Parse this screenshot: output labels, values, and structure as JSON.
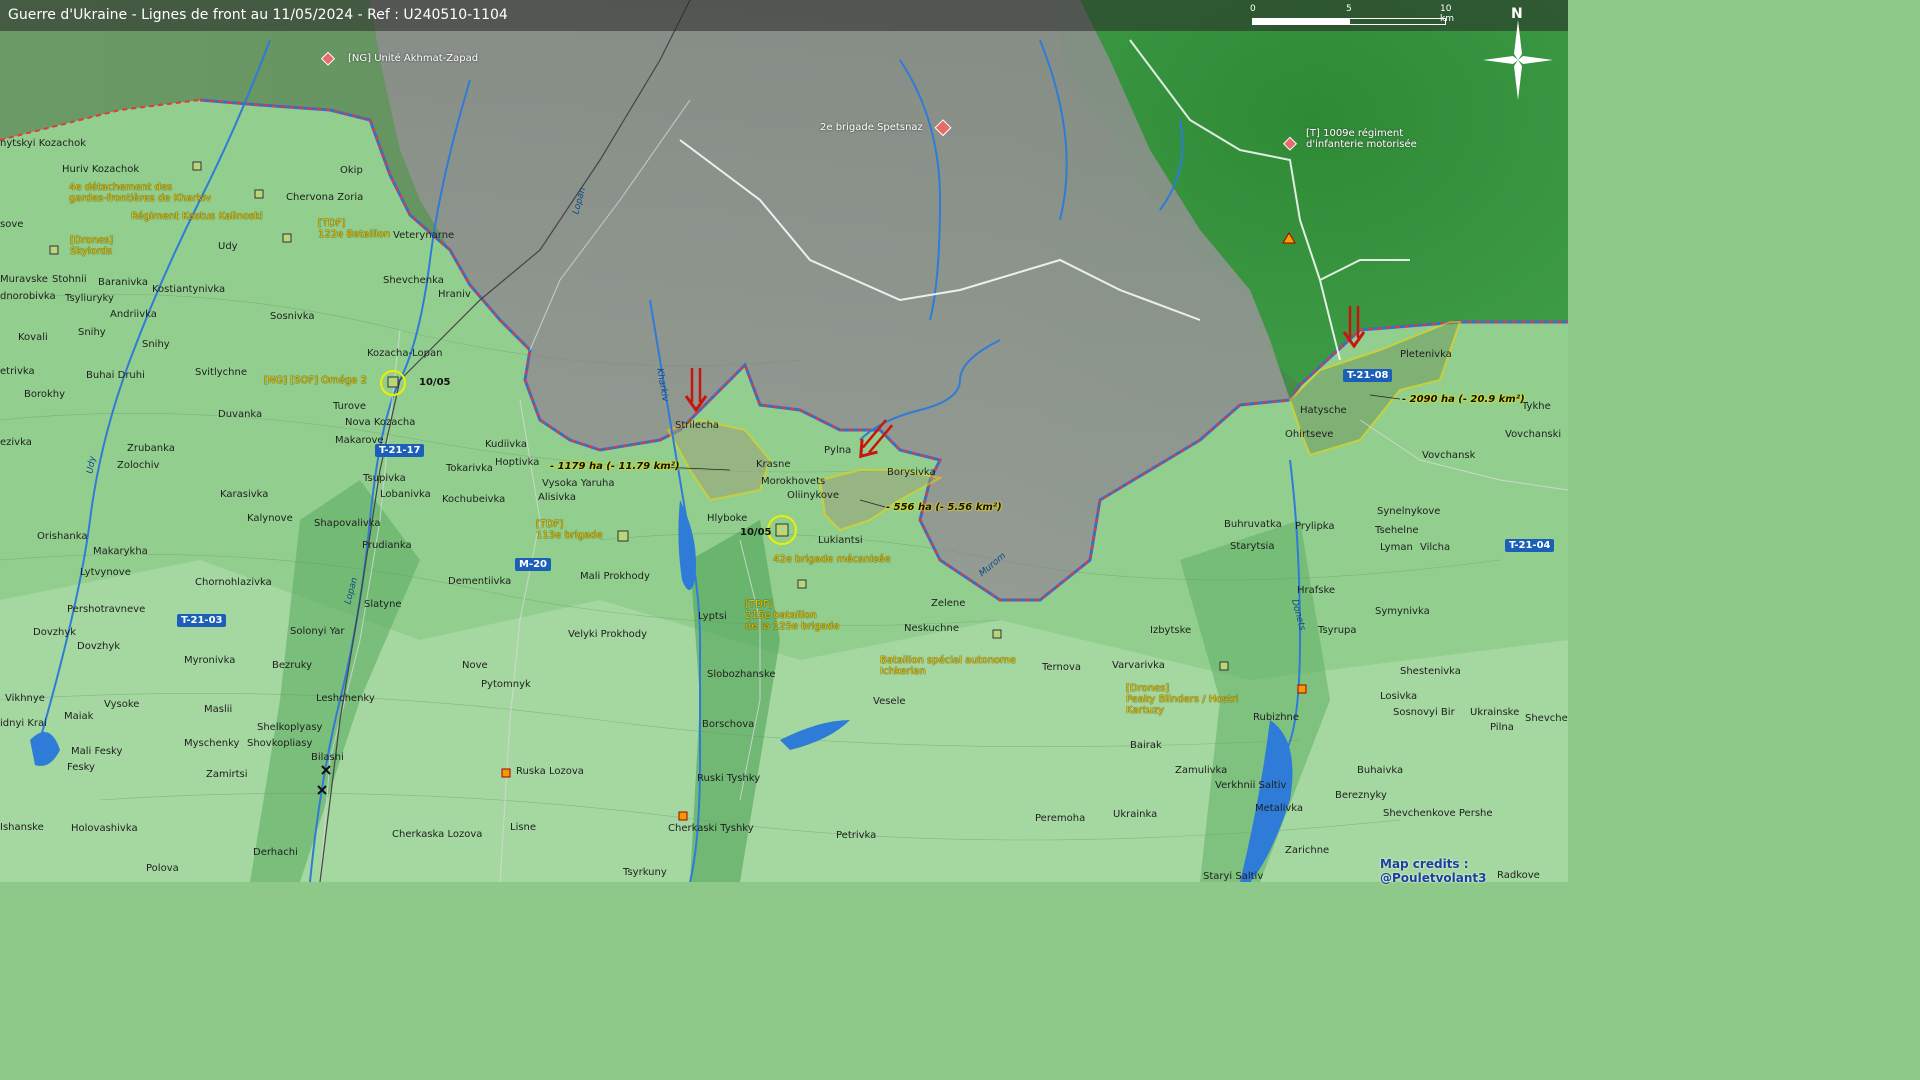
{
  "title": "Guerre d'Ukraine - Lignes de front au 11/05/2024 - Ref : U240510-1104",
  "scale": {
    "l0": "0",
    "l5": "5",
    "l10": "10 km"
  },
  "north": "N",
  "credits": "Map credits : @Pouletvolant3",
  "colors": {
    "occupied": "#8a8a8a",
    "frontline": "#d23a3a",
    "advance": "#f1d200",
    "arrow": "#c8150d",
    "water": "#2f7bd8",
    "road_badge": "#1c5fb8"
  },
  "places": {
    "p1": "nytskyi Kozachok",
    "p2": "Huriv Kozachok",
    "p3": "Okip",
    "p4": "Chervona Zoria",
    "p5": "Veterynarne",
    "p6": "Udy",
    "p7": "sove",
    "p8": "Muravske",
    "p9": "Stohnii",
    "p10": "Baranivka",
    "p11": "Kostiantynivka",
    "p12": "Shevchenka",
    "p13": "Hraniv",
    "p14": "dnorobivka",
    "p15": "Tsyliuryky",
    "p16": "Andriivka",
    "p17": "Sosnivka",
    "p18": "Kovali",
    "p19": "Snihy",
    "p20": "Snihy",
    "p21": "Kozacha-Lopan",
    "p22": "etrivka",
    "p23": "Buhai Druhi",
    "p24": "Svitlychne",
    "p25": "Borokhy",
    "p26": "Turove",
    "p27": "Duvanka",
    "p28": "Nova Kozacha",
    "p29": "Makarove",
    "p30": "ezivka",
    "p31": "Zrubanka",
    "p32": "Kudiivka",
    "p33": "Hoptivka",
    "p34": "Zolochiv",
    "p35": "Tokarivka",
    "p36": "Tsupivka",
    "p37": "Vysoka Yaruha",
    "p38": "Karasivka",
    "p39": "Lobanivka",
    "p40": "Alisivka",
    "p41": "Kochubeivka",
    "p42": "Kalynove",
    "p43": "Shapovalivka",
    "p44": "Orishanka",
    "p45": "Makarykha",
    "p46": "Prudianka",
    "p47": "Lytvynove",
    "p48": "Chornohlazivka",
    "p49": "Dementiivka",
    "p50": "Pershotravneve",
    "p51": "Slatyne",
    "p52": "Dovzhyk",
    "p53": "Dovzhyk",
    "p54": "Solonyi Yar",
    "p55": "Myronivka",
    "p56": "Bezruky",
    "p57": "Vikhnye",
    "p58": "Vysoke",
    "p59": "Leshchenky",
    "p60": "idnyi Krai",
    "p61": "Maiak",
    "p62": "Maslii",
    "p63": "Shelkoplyasy",
    "p64": "Myschenky",
    "p65": "Shovkopliasy",
    "p66": "Mali Fesky",
    "p67": "Fesky",
    "p68": "Bilashi",
    "p69": "Zamirtsi",
    "p70": "Ishanske",
    "p71": "Holovashivka",
    "p72": "Derhachi",
    "p73": "Polova",
    "p74": "Strilecha",
    "p75": "Krasne",
    "p76": "Pylna",
    "p77": "Morokhovets",
    "p78": "Borysivka",
    "p79": "Oliinykove",
    "p80": "Hlyboke",
    "p81": "Lukiantsi",
    "p82": "Mali Prokhody",
    "p83": "Velyki Prokhody",
    "p84": "Lyptsi",
    "p85": "Nove",
    "p86": "Pytomnyk",
    "p87": "Slobozhanske",
    "p88": "Borschova",
    "p89": "Ruska Lozova",
    "p90": "Ruski Tyshky",
    "p91": "Cherkaski Tyshky",
    "p92": "Lisne",
    "p93": "Cherkaska Lozova",
    "p94": "Petrivka",
    "p95": "Tsyrkuny",
    "p96": "Zelene",
    "p97": "Neskuchne",
    "p98": "Ternova",
    "p99": "Vesele",
    "p100": "Izbytske",
    "p101": "Varvarivka",
    "p102": "Peremoha",
    "p103": "Ukrainka",
    "p104": "Bairak",
    "p105": "Zamulivka",
    "p106": "Verkhnii Saltiv",
    "p107": "Metalivka",
    "p108": "Rubizhne",
    "p109": "Buhruvatka",
    "p110": "Prylipka",
    "p111": "Starytsia",
    "p112": "Hatysche",
    "p113": "Ohirtseve",
    "p114": "Pletenivka",
    "p115": "Tykhe",
    "p116": "Vovchanski",
    "p117": "Vovchansk",
    "p118": "Synelnykove",
    "p119": "Tsehelne",
    "p120": "Lyman",
    "p121": "Vilcha",
    "p122": "Hrafske",
    "p123": "Symynivka",
    "p124": "Tsyrupa",
    "p125": "Shestenivka",
    "p126": "Losivka",
    "p127": "Sosnovyi Bir",
    "p128": "Ukrainske",
    "p129": "Pilna",
    "p130": "Buhaivka",
    "p131": "Bereznyky",
    "p132": "Shevchenkove Pershe",
    "p133": "Zarichne",
    "p134": "Staryi Saltiv",
    "p135": "Radkove",
    "p136": "Shevche"
  },
  "units": {
    "u1": "[NG] Unité Akhmat-Zapad",
    "u2": "2e brigade Spetsnaz",
    "u3a": "[T] 1009e régiment",
    "u3b": "d'infanterie motorisée",
    "u4a": "4e détachement des",
    "u4b": "gardes-frontières de Kharkiv",
    "u5": "Régiment Kastus Kalinoski",
    "u6a": "[TDF]",
    "u6b": "122e Bataillon",
    "u7a": "[Drones]",
    "u7b": "Skylords",
    "u8": "[NG] [SOF] Oméga 2",
    "u9a": "[TDF]",
    "u9b": "113e brigade",
    "u10": "42e brigade mécanisée",
    "u11a": "[TDF]",
    "u11b": "215e bataillon",
    "u11c": "de la 125e brigade",
    "u12a": "Bataillon spécial autonome",
    "u12b": "Ichkerian",
    "u13a": "[Drones]",
    "u13b": "Peaky Blinders / Hostri",
    "u13c": "Kartuzy"
  },
  "areas": {
    "a1": "- 1179 ha (- 11.79 km²)",
    "a2": "- 556 ha (- 5.56 km²)",
    "a3": "- 2090 ha (- 20.9 km²)"
  },
  "dates": {
    "d1": "10/05",
    "d2": "10/05"
  },
  "roads": {
    "r1": "T-21-17",
    "r2": "M-20",
    "r3": "T-21-03",
    "r4": "T-21-08",
    "r5": "T-21-04"
  },
  "rivers": {
    "v1": "Lopan",
    "v2": "Kharkiv",
    "v3": "Udy",
    "v4": "Lopan",
    "v5": "Murom",
    "v6": "Donets"
  }
}
